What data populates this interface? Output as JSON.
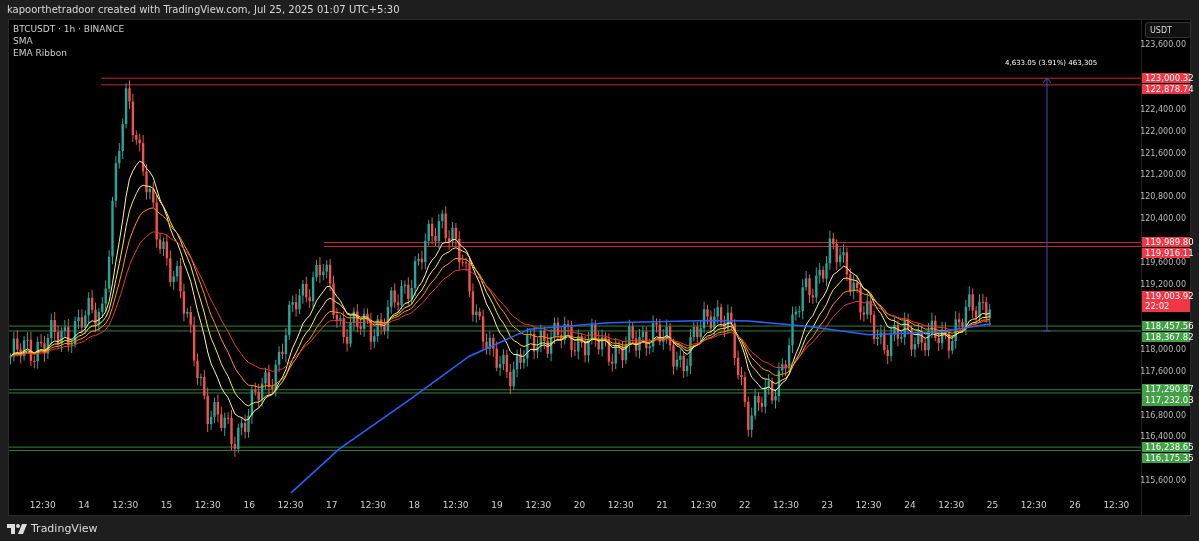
{
  "header": {
    "text": "kapoorthetradoor created with TradingView.com, Jul 25, 2025 01:07 UTC+5:30"
  },
  "legend": [
    "BTCUSDT · 1h · BINANCE",
    "SMA",
    "EMA Ribbon"
  ],
  "currency_button": "USDT",
  "price_axis": [
    "123,600.00",
    "122,400.00",
    "122,000.00",
    "121,600.00",
    "121,200.00",
    "120,800.00",
    "120,400.00",
    "119,600.00",
    "119,200.00",
    "118,000.00",
    "117,600.00",
    "116,800.00",
    "116,400.00",
    "115,600.00"
  ],
  "price_tags": [
    {
      "text": "123,000.32",
      "color": "#f23645"
    },
    {
      "text": "122,878.74",
      "color": "#f23645"
    },
    {
      "text": "119,989.80",
      "color": "#f23645"
    },
    {
      "text": "119,916.11",
      "color": "#f23645"
    },
    {
      "text": "119,003.92",
      "subtext": "22:02",
      "color": "#f23645"
    },
    {
      "text": "118,457.56",
      "color": "#43a047"
    },
    {
      "text": "118,367.82",
      "color": "#43a047"
    },
    {
      "text": "117,290.87",
      "color": "#43a047"
    },
    {
      "text": "117,232.03",
      "color": "#43a047"
    },
    {
      "text": "116,238.65",
      "color": "#43a047"
    },
    {
      "text": "116,175.35",
      "color": "#43a047"
    }
  ],
  "measure": {
    "label": "4,633.05 (3.91%) 463,305"
  },
  "time_axis": [
    "12:30",
    "14",
    "12:30",
    "15",
    "12:30",
    "16",
    "12:30",
    "17",
    "12:30",
    "18",
    "12:30",
    "19",
    "12:30",
    "20",
    "12:30",
    "21",
    "12:30",
    "22",
    "12:30",
    "23",
    "12:30",
    "24",
    "12:30",
    "25",
    "12:30",
    "26",
    "12:30"
  ],
  "footer": {
    "brand": "TradingView"
  }
}
